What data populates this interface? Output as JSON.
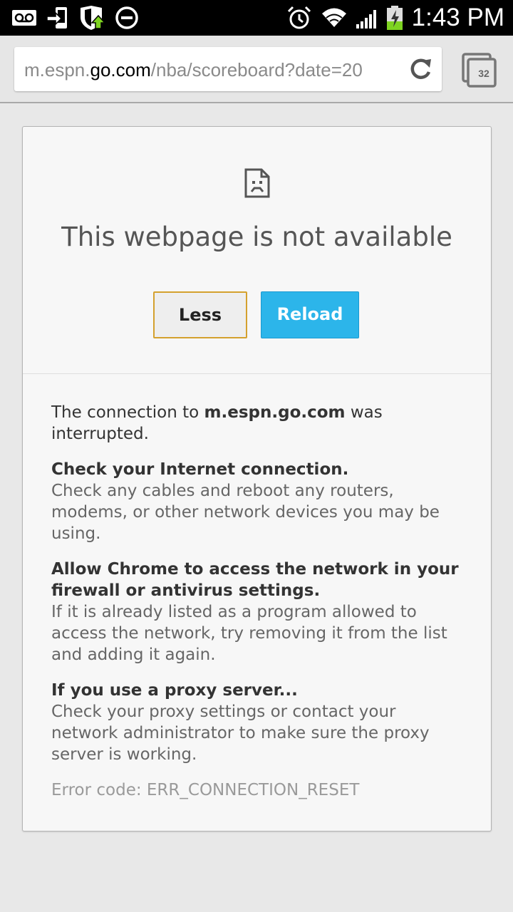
{
  "status_bar": {
    "icons": [
      "voicemail-icon",
      "sim-transfer-icon",
      "shield-update-icon",
      "do-not-disturb-icon",
      "alarm-icon",
      "wifi-icon",
      "signal-icon",
      "battery-charging-icon"
    ],
    "time": "1:43 PM"
  },
  "toolbar": {
    "url_domain_prefix": "m.espn.",
    "url_domain": "go.com",
    "url_path": "/nba/scoreboard?date=20",
    "tab_count": "32"
  },
  "error": {
    "title": "This webpage is not available",
    "less_label": "Less",
    "reload_label": "Reload",
    "intro_before": "The connection to ",
    "intro_host": "m.espn.go.com",
    "intro_after": " was interrupted.",
    "tip1_heading": "Check your Internet connection.",
    "tip1_body": "Check any cables and reboot any routers, modems, or other network devices you may be using.",
    "tip2_heading": "Allow Chrome to access the network in your firewall or antivirus settings.",
    "tip2_body": "If it is already listed as a program allowed to access the network, try removing it from the list and adding it again.",
    "tip3_heading": "If you use a proxy server...",
    "tip3_body": "Check your proxy settings or contact your network administrator to make sure the proxy server is working.",
    "error_code": "Error code: ERR_CONNECTION_RESET"
  },
  "colors": {
    "reload_button": "#2cb5ea",
    "less_button_border": "#d4a12e",
    "status_bar": "#000000"
  }
}
